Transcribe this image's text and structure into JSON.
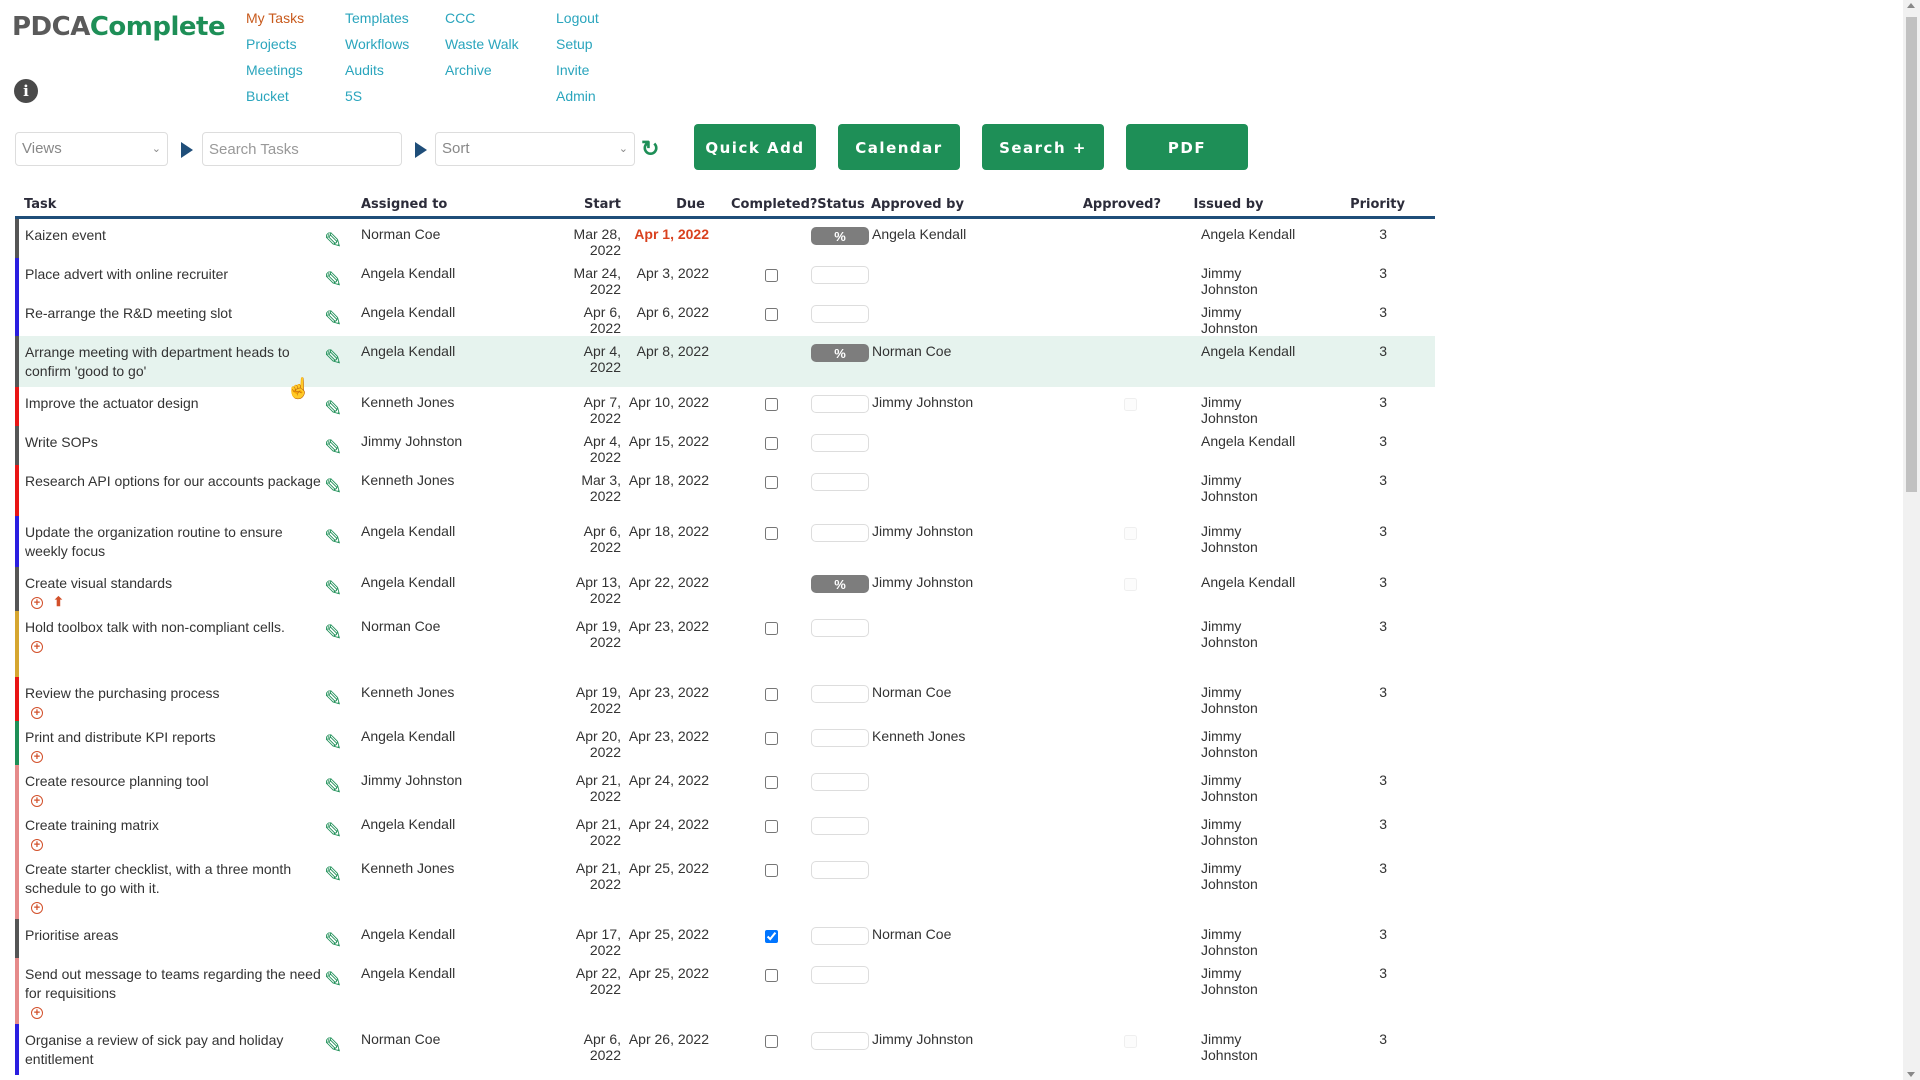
{
  "app": {
    "logo_part1": "PDCA",
    "logo_part2": "Complete",
    "info_glyph": "i"
  },
  "nav": {
    "col1": [
      {
        "label": "My Tasks",
        "active": true
      },
      {
        "label": "Projects"
      },
      {
        "label": "Meetings"
      },
      {
        "label": "Bucket"
      }
    ],
    "col2": [
      {
        "label": "Templates"
      },
      {
        "label": "Workflows"
      },
      {
        "label": "Audits"
      },
      {
        "label": "5S"
      }
    ],
    "col3": [
      {
        "label": "CCC"
      },
      {
        "label": "Waste Walk"
      },
      {
        "label": "Archive"
      }
    ],
    "col4": [
      {
        "label": "Logout"
      },
      {
        "label": "Setup"
      },
      {
        "label": "Invite"
      },
      {
        "label": "Admin"
      }
    ]
  },
  "toolbar": {
    "views_selected": "Views",
    "search_placeholder": "Search Tasks",
    "sort_selected": "Sort",
    "refresh_icon": "↻",
    "quick_add_label": "Quick Add",
    "calendar_label": "Calendar",
    "search_plus_label": "Search +",
    "pdf_label": "PDF"
  },
  "table": {
    "headers": {
      "task": "Task",
      "assigned_to": "Assigned to",
      "start": "Start",
      "due": "Due",
      "completed": "Completed?",
      "status": "Status",
      "approved_by": "Approved by",
      "approved": "Approved?",
      "issued_by": "Issued by",
      "priority": "Priority"
    },
    "category_colors": {
      "gray": "#555555",
      "blue": "#2a1ee0",
      "red": "#e81515",
      "yellow": "#d6a630",
      "green": "#1e8f57",
      "pink": "#e58a8a"
    },
    "rows": [
      {
        "task": "Kaizen event",
        "bar": "gray",
        "assigned": "Norman Coe",
        "start": "Mar 28, 2022",
        "due": "Apr 1, 2022",
        "overdue": true,
        "completed": null,
        "status": "%",
        "approved_by": "Angela Kendall",
        "approved": null,
        "issued_by": "Angela Kendall",
        "priority": "3",
        "icons": []
      },
      {
        "task": "Place advert with online recruiter",
        "bar": "blue",
        "assigned": "Angela Kendall",
        "start": "Mar 24, 2022",
        "due": "Apr 3, 2022",
        "completed": false,
        "status": "",
        "approved_by": "",
        "approved": null,
        "issued_by": "Jimmy Johnston",
        "priority": "3",
        "icons": []
      },
      {
        "task": "Re-arrange the R&D meeting slot",
        "bar": "blue",
        "assigned": "Angela Kendall",
        "start": "Apr 6, 2022",
        "due": "Apr 6, 2022",
        "completed": false,
        "status": "",
        "approved_by": "",
        "approved": null,
        "issued_by": "Jimmy Johnston",
        "priority": "3",
        "icons": []
      },
      {
        "task": "Arrange meeting with department heads to confirm 'good to go'",
        "bar": "gray",
        "assigned": "Angela Kendall",
        "start": "Apr 4, 2022",
        "due": "Apr 8, 2022",
        "completed": null,
        "status": "%",
        "approved_by": "Norman Coe",
        "approved": null,
        "issued_by": "Angela Kendall",
        "priority": "3",
        "icons": [],
        "highlighted": true
      },
      {
        "task": "Improve the actuator design",
        "bar": "red",
        "assigned": "Kenneth Jones",
        "start": "Apr 7, 2022",
        "due": "Apr 10, 2022",
        "completed": false,
        "status": "",
        "approved_by": "Jimmy Johnston",
        "approved": false,
        "issued_by": "Jimmy Johnston",
        "priority": "3",
        "icons": []
      },
      {
        "task": "Write SOPs",
        "bar": "gray",
        "assigned": "Jimmy Johnston",
        "start": "Apr 4, 2022",
        "due": "Apr 15, 2022",
        "completed": false,
        "status": "",
        "approved_by": "",
        "approved": null,
        "issued_by": "Angela Kendall",
        "priority": "3",
        "icons": []
      },
      {
        "task": "Research API options for our accounts package",
        "bar": "red",
        "assigned": "Kenneth Jones",
        "start": "Mar 3, 2022",
        "due": "Apr 18, 2022",
        "completed": false,
        "status": "",
        "approved_by": "",
        "approved": null,
        "issued_by": "Jimmy Johnston",
        "priority": "3",
        "icons": []
      },
      {
        "task": "Update the organization routine to ensure weekly focus",
        "bar": "blue",
        "assigned": "Angela Kendall",
        "start": "Apr 6, 2022",
        "due": "Apr 18, 2022",
        "completed": false,
        "status": "",
        "approved_by": "Jimmy Johnston",
        "approved": false,
        "issued_by": "Jimmy Johnston",
        "priority": "3",
        "icons": []
      },
      {
        "task": "Create visual standards",
        "bar": "gray",
        "assigned": "Angela Kendall",
        "start": "Apr 13, 2022",
        "due": "Apr 22, 2022",
        "completed": null,
        "status": "%",
        "approved_by": "Jimmy Johnston",
        "approved": false,
        "issued_by": "Angela Kendall",
        "priority": "3",
        "icons": [
          "plus",
          "upload"
        ]
      },
      {
        "task": "Hold toolbox talk with non-compliant cells.",
        "bar": "yellow",
        "assigned": "Norman Coe",
        "start": "Apr 19, 2022",
        "due": "Apr 23, 2022",
        "completed": false,
        "status": "",
        "approved_by": "",
        "approved": null,
        "issued_by": "Jimmy Johnston",
        "priority": "3",
        "icons": [
          "plus"
        ]
      },
      {
        "task": "Review the purchasing process",
        "bar": "red",
        "assigned": "Kenneth Jones",
        "start": "Apr 19, 2022",
        "due": "Apr 23, 2022",
        "completed": false,
        "status": "",
        "approved_by": "Norman Coe",
        "approved": null,
        "issued_by": "Jimmy Johnston",
        "priority": "3",
        "icons": [
          "plus"
        ]
      },
      {
        "task": "Print and distribute KPI reports",
        "bar": "green",
        "assigned": "Angela Kendall",
        "start": "Apr 20, 2022",
        "due": "Apr 23, 2022",
        "completed": false,
        "status": "",
        "approved_by": "Kenneth Jones",
        "approved": null,
        "issued_by": "Jimmy Johnston",
        "priority": "",
        "icons": [
          "plus"
        ]
      },
      {
        "task": "Create resource planning tool",
        "bar": "pink",
        "assigned": "Jimmy Johnston",
        "start": "Apr 21, 2022",
        "due": "Apr 24, 2022",
        "completed": false,
        "status": "",
        "approved_by": "",
        "approved": null,
        "issued_by": "Jimmy Johnston",
        "priority": "3",
        "icons": [
          "plus"
        ]
      },
      {
        "task": "Create training matrix",
        "bar": "pink",
        "assigned": "Angela Kendall",
        "start": "Apr 21, 2022",
        "due": "Apr 24, 2022",
        "completed": false,
        "status": "",
        "approved_by": "",
        "approved": null,
        "issued_by": "Jimmy Johnston",
        "priority": "3",
        "icons": [
          "plus"
        ]
      },
      {
        "task": "Create starter checklist, with a three month schedule to go with it.",
        "bar": "pink",
        "assigned": "Kenneth Jones",
        "start": "Apr 21, 2022",
        "due": "Apr 25, 2022",
        "completed": false,
        "status": "",
        "approved_by": "",
        "approved": null,
        "issued_by": "Jimmy Johnston",
        "priority": "3",
        "icons": [
          "plus"
        ]
      },
      {
        "task": "Prioritise areas",
        "bar": "gray",
        "assigned": "Angela Kendall",
        "start": "Apr 17, 2022",
        "due": "Apr 25, 2022",
        "completed": true,
        "status": "",
        "approved_by": "Norman Coe",
        "approved": null,
        "issued_by": "Jimmy Johnston",
        "priority": "3",
        "icons": []
      },
      {
        "task": "Send out message to teams regarding the need for requisitions",
        "bar": "pink",
        "assigned": "Angela Kendall",
        "start": "Apr 22, 2022",
        "due": "Apr 25, 2022",
        "completed": false,
        "status": "",
        "approved_by": "",
        "approved": null,
        "issued_by": "Jimmy Johnston",
        "priority": "3",
        "icons": [
          "plus"
        ]
      },
      {
        "task": "Organise a review of sick pay and holiday entitlement",
        "bar": "blue",
        "assigned": "Norman Coe",
        "start": "Apr 6, 2022",
        "due": "Apr 26, 2022",
        "completed": false,
        "status": "",
        "approved_by": "Jimmy Johnston",
        "approved": false,
        "issued_by": "Jimmy Johnston",
        "priority": "3",
        "icons": []
      }
    ]
  }
}
